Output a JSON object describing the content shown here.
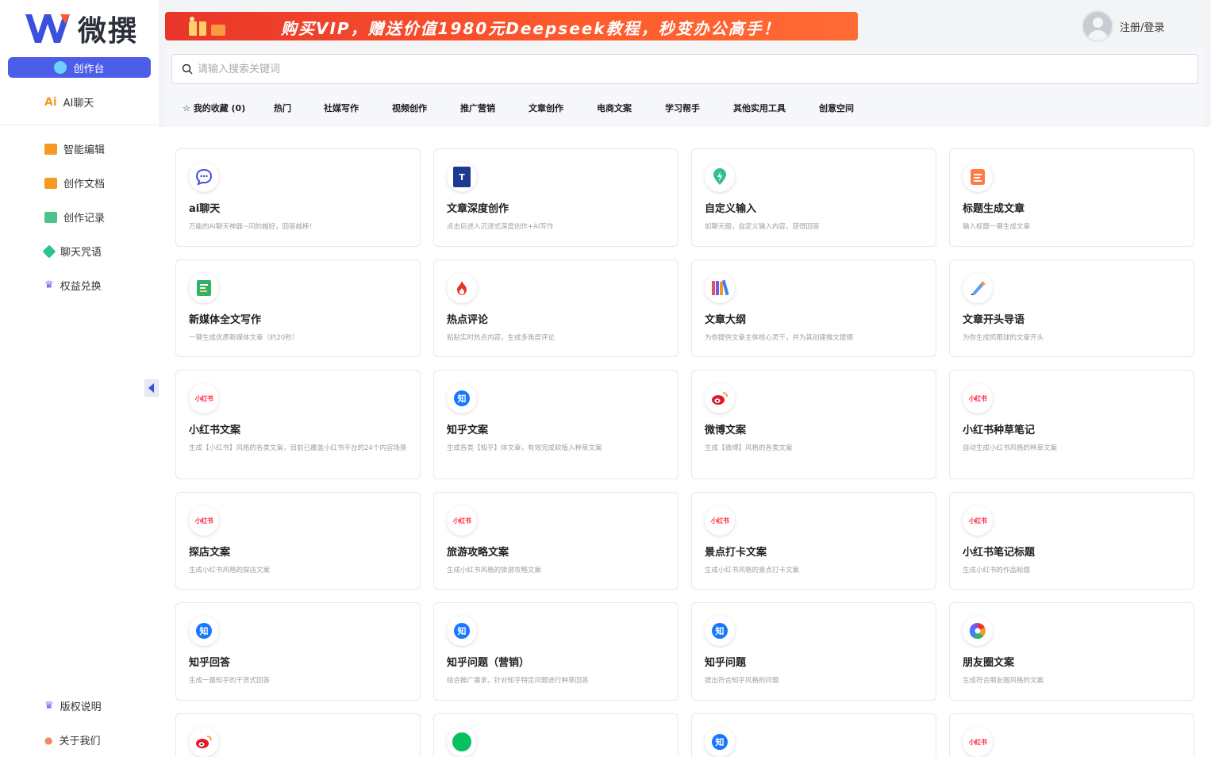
{
  "app": {
    "logo_text": "微撰"
  },
  "sidebar": {
    "primary": {
      "label": "创作台",
      "icon": "bulb-icon"
    },
    "ai_chat": {
      "label": "AI聊天",
      "badge": "Ai"
    },
    "items": [
      {
        "label": "智能编辑",
        "icon": "folder-icon",
        "color": "#f59a23"
      },
      {
        "label": "创作文档",
        "icon": "folder-icon",
        "color": "#f59a23"
      },
      {
        "label": "创作记录",
        "icon": "record-icon",
        "color": "#4cc38a"
      },
      {
        "label": "聊天咒语",
        "icon": "gem-icon",
        "color": "#2fc28b"
      },
      {
        "label": "权益兑换",
        "icon": "crown-icon",
        "color": "#6b5cf6"
      }
    ],
    "bottom": [
      {
        "label": "版权说明",
        "icon": "crown-icon"
      },
      {
        "label": "关于我们",
        "icon": "person-icon"
      }
    ]
  },
  "banner": {
    "text": "购买VIP，赠送价值1980元Deepseek教程，秒变办公高手！"
  },
  "user": {
    "login_label": "注册/登录"
  },
  "search": {
    "placeholder": "请输入搜索关键词"
  },
  "tabs": [
    "☆ 我的收藏 (0)",
    "热门",
    "社媒写作",
    "视频创作",
    "推广营销",
    "文章创作",
    "电商文案",
    "学习帮手",
    "其他实用工具",
    "创意空间"
  ],
  "cards": [
    {
      "title": "ai聊天",
      "desc": "万能的AI聊天神器~问的越好，回答越棒！",
      "icon": "chat-icon"
    },
    {
      "title": "文章深度创作",
      "desc": "点击后进入沉浸式深度创作+AI写作",
      "icon": "doc-t-icon"
    },
    {
      "title": "自定义输入",
      "desc": "如聊天般，自定义输入内容，获得回答",
      "icon": "lightning-icon"
    },
    {
      "title": "标题生成文章",
      "desc": "输入标题一键生成文章",
      "icon": "article-icon"
    },
    {
      "title": "新媒体全文写作",
      "desc": "一键生成优质新媒体文章（约20秒）",
      "icon": "sheet-icon"
    },
    {
      "title": "热点评论",
      "desc": "粘贴实时热点内容，生成多角度评论",
      "icon": "fire-icon"
    },
    {
      "title": "文章大纲",
      "desc": "为你提供文章主体核心灵干，并为其创建推文提纲",
      "icon": "books-icon"
    },
    {
      "title": "文章开头导语",
      "desc": "为你生成抓眼球的文章开头",
      "icon": "brush-icon"
    },
    {
      "title": "小红书文案",
      "desc": "生成【小红书】风格的各类文案，目前已覆盖小红书平台的24个内容场景",
      "icon": "xiaohongshu-icon"
    },
    {
      "title": "知乎文案",
      "desc": "生成各类【知乎】体文章，有效完成软植入种草文案",
      "icon": "zhihu-icon"
    },
    {
      "title": "微博文案",
      "desc": "生成【微博】风格的各类文案",
      "icon": "weibo-icon"
    },
    {
      "title": "小红书种草笔记",
      "desc": "自动生成小红书风格的种草文案",
      "icon": "xiaohongshu-icon"
    },
    {
      "title": "探店文案",
      "desc": "生成小红书风格的探店文案",
      "icon": "xiaohongshu-icon"
    },
    {
      "title": "旅游攻略文案",
      "desc": "生成小红书风格的旅游攻略文案",
      "icon": "xiaohongshu-icon"
    },
    {
      "title": "景点打卡文案",
      "desc": "生成小红书风格的景点打卡文案",
      "icon": "xiaohongshu-icon"
    },
    {
      "title": "小红书笔记标题",
      "desc": "生成小红书的作品标题",
      "icon": "xiaohongshu-icon"
    },
    {
      "title": "知乎回答",
      "desc": "生成一篇知乎的干货式回答",
      "icon": "zhihu-icon"
    },
    {
      "title": "知乎问题（营销）",
      "desc": "结合推广需求，针对知乎特定问题进行种草回答",
      "icon": "zhihu-icon"
    },
    {
      "title": "知乎问题",
      "desc": "提出符合知乎风格的问题",
      "icon": "zhihu-icon"
    },
    {
      "title": "朋友圈文案",
      "desc": "生成符合朋友圈风格的文案",
      "icon": "moments-icon"
    },
    {
      "title": "",
      "desc": "",
      "icon": "weibo-icon"
    },
    {
      "title": "",
      "desc": "",
      "icon": "wechat-icon"
    },
    {
      "title": "",
      "desc": "",
      "icon": "zhihu-icon"
    },
    {
      "title": "",
      "desc": "",
      "icon": "xiaohongshu-icon"
    }
  ],
  "icon_text": {
    "xiaohongshu": "小红书",
    "zhihu": "知",
    "doc": "T"
  }
}
